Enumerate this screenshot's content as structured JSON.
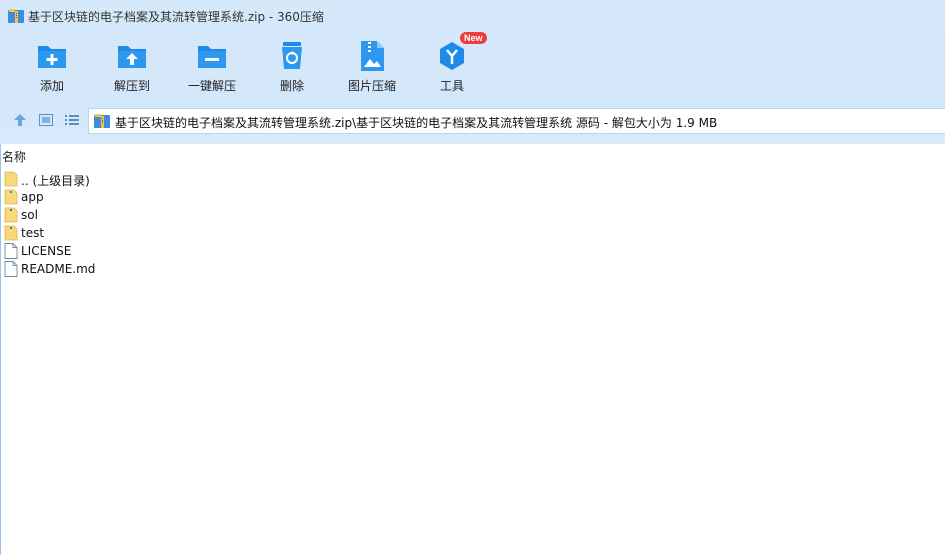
{
  "window": {
    "title": "基于区块链的电子档案及其流转管理系统.zip - 360压缩"
  },
  "toolbar": {
    "items": [
      {
        "label": "添加",
        "icon": "add-folder-icon"
      },
      {
        "label": "解压到",
        "icon": "extract-to-icon"
      },
      {
        "label": "一键解压",
        "icon": "one-click-extract-icon"
      },
      {
        "label": "删除",
        "icon": "recycle-bin-icon"
      },
      {
        "label": "图片压缩",
        "icon": "image-compress-icon"
      },
      {
        "label": "工具",
        "icon": "tools-icon",
        "badge": "New"
      }
    ]
  },
  "nav": {
    "path": "基于区块链的电子档案及其流转管理系统.zip\\基于区块链的电子档案及其流转管理系统 源码 - 解包大小为 1.9 MB"
  },
  "list": {
    "column_header": "名称",
    "items": [
      {
        "name": ".. (上级目录)",
        "type": "folder"
      },
      {
        "name": "app",
        "type": "folder"
      },
      {
        "name": "sol",
        "type": "folder"
      },
      {
        "name": "test",
        "type": "folder"
      },
      {
        "name": "LICENSE",
        "type": "file"
      },
      {
        "name": "README.md",
        "type": "file"
      }
    ]
  },
  "colors": {
    "toolbar_bg": "#d6e9fb",
    "icon_blue": "#1e8be8",
    "badge_red": "#ef3b3b",
    "folder_yellow": "#f7d87a"
  }
}
